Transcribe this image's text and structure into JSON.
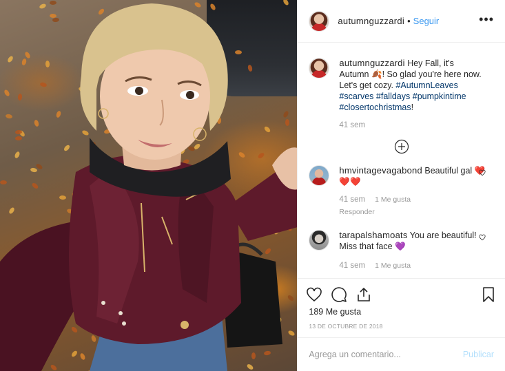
{
  "post": {
    "username": "autumnguzzardi",
    "follow_label": "Seguir",
    "separator": "•",
    "more_label": "•••"
  },
  "caption": {
    "username": "autumnguzzardi",
    "text_before": "Hey Fall, it's Autumn",
    "emoji": "🍂",
    "text_after": "! So glad you're here now. Let's get cozy.",
    "hashtags": [
      "#AutumnLeaves",
      "#scarves",
      "#falldays",
      "#pumpkintime",
      "#closertochristmas"
    ],
    "end": "!",
    "time": "41 sem"
  },
  "comments": [
    {
      "username": "hmvintagevagabond",
      "text": "Beautiful gal",
      "emoji": "❤️❤️❤️",
      "time": "41 sem",
      "likes": "1 Me gusta",
      "reply": "Responder"
    },
    {
      "username": "tarapalshamoats",
      "text": "You are beautiful! Miss that face",
      "emoji": "💜",
      "time": "41 sem",
      "likes": "1 Me gusta"
    }
  ],
  "footer": {
    "likes": "189 Me gusta",
    "date": "13 DE OCTUBRE DE 2018",
    "comment_placeholder": "Agrega un comentario...",
    "publish_label": "Publicar"
  },
  "colors": {
    "link": "#3897f0",
    "hashtag": "#003569",
    "muted": "#999999",
    "publish_disabled": "#b2dffc",
    "jacket": "#5e1a2b"
  }
}
